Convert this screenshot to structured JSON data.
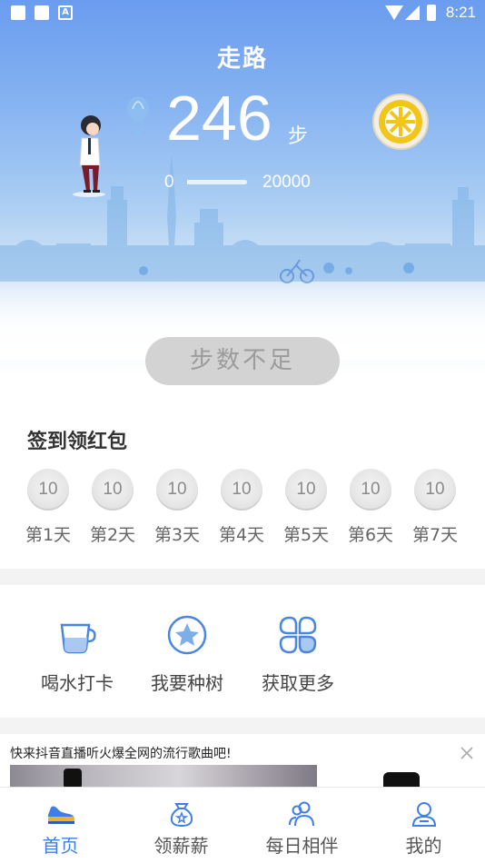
{
  "status_bar": {
    "time": "8:21"
  },
  "header": {
    "title": "走路"
  },
  "steps": {
    "count": "246",
    "unit": "步",
    "range_min": "0",
    "range_max": "20000",
    "progress_fraction": 0.0123
  },
  "main_button": {
    "label": "步数不足",
    "state": "disabled"
  },
  "checkin": {
    "title": "签到领红包",
    "days": [
      {
        "reward": "10",
        "label": "第1天"
      },
      {
        "reward": "10",
        "label": "第2天"
      },
      {
        "reward": "10",
        "label": "第3天"
      },
      {
        "reward": "10",
        "label": "第4天"
      },
      {
        "reward": "10",
        "label": "第5天"
      },
      {
        "reward": "10",
        "label": "第6天"
      },
      {
        "reward": "10",
        "label": "第7天"
      }
    ]
  },
  "actions": [
    {
      "label": "喝水打卡",
      "icon": "cup-icon"
    },
    {
      "label": "我要种树",
      "icon": "star-icon"
    },
    {
      "label": "获取更多",
      "icon": "grid-icon"
    }
  ],
  "ad": {
    "text": "快来抖音直播听火爆全网的流行歌曲吧!"
  },
  "bottom_nav": {
    "items": [
      {
        "label": "首页",
        "icon": "shoe-icon",
        "active": true
      },
      {
        "label": "领薪薪",
        "icon": "money-bag-icon",
        "active": false
      },
      {
        "label": "每日相伴",
        "icon": "friends-icon",
        "active": false
      },
      {
        "label": "我的",
        "icon": "profile-icon",
        "active": false
      }
    ]
  },
  "colors": {
    "hero_top": "#6a9cf0",
    "accent": "#3f7ee8",
    "button_disabled": "#d3d3d3",
    "coin_gold": "#f2c51b"
  }
}
